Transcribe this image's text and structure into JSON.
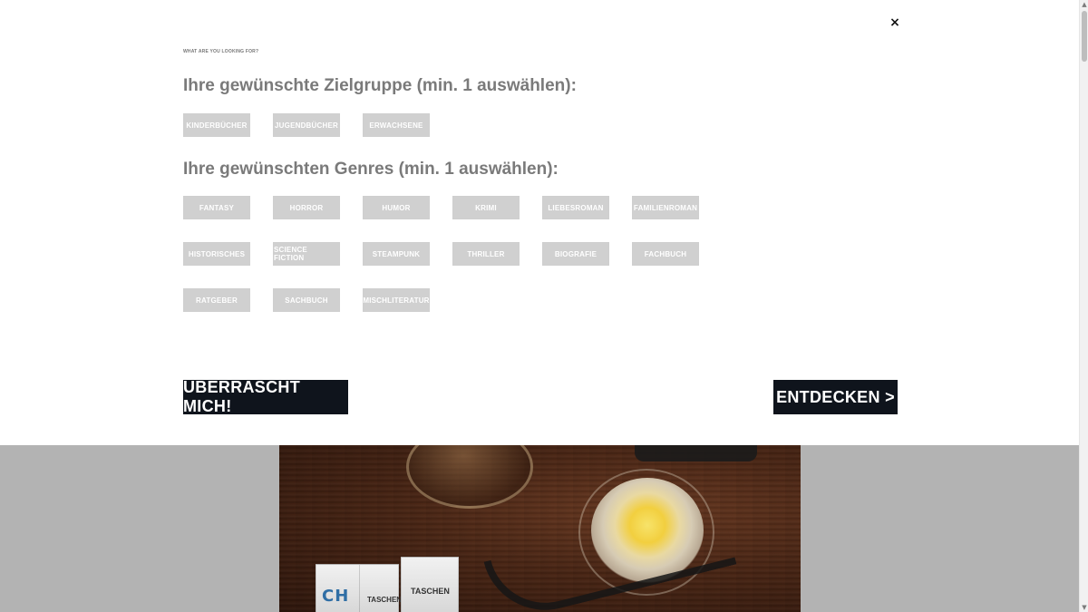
{
  "overlay": {
    "close_icon": "×",
    "kicker": "WHAT ARE YOU LOOKING FOR?",
    "target_group": {
      "title": "Ihre gewünschte Zielgruppe (min. 1 auswählen):",
      "chips": [
        "KINDERBÜCHER",
        "JUGENDBÜCHER",
        "ERWACHSENE"
      ]
    },
    "genres": {
      "title": "Ihre gewünschten Genres (min. 1 auswählen):",
      "chips": [
        "FANTASY",
        "HORROR",
        "HUMOR",
        "KRIMI",
        "LIEBESROMAN",
        "FAMILIENROMAN",
        "HISTORISCHES",
        "SCIENCE FICTION",
        "STEAMPUNK",
        "THRILLER",
        "BIOGRAFIE",
        "FACHBUCH",
        "RATGEBER",
        "SACHBUCH",
        "MISCHLITERATUR"
      ]
    },
    "actions": {
      "surprise": "ÜBERRASCHT MICH!",
      "discover": "ENTDECKEN >"
    }
  },
  "background": {
    "book_spine_text": "CH",
    "brand_1": "TASCHEN",
    "brand_2": "TASCHEN"
  },
  "scrollbar": {
    "up_icon": "▲",
    "down_icon": "▼"
  }
}
